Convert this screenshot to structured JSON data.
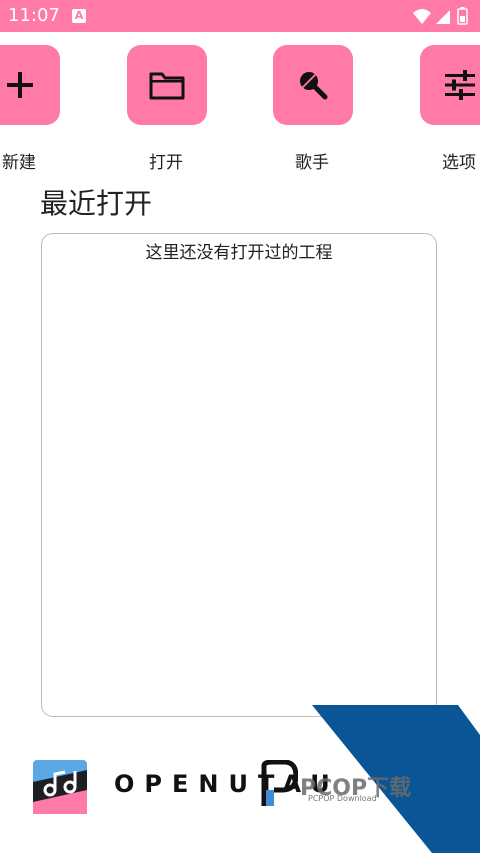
{
  "status_bar": {
    "time": "11:07",
    "app_badge": "A",
    "bg_color": "#ff7aa8"
  },
  "actions": [
    {
      "label": "新建",
      "icon": "plus-icon"
    },
    {
      "label": "打开",
      "icon": "folder-icon"
    },
    {
      "label": "歌手",
      "icon": "microphone-icon"
    },
    {
      "label": "选项",
      "icon": "sliders-icon"
    }
  ],
  "recent": {
    "title": "最近打开",
    "empty_text": "这里还没有打开过的工程"
  },
  "footer": {
    "brand": "OPENUTAU",
    "logo_icon": "openutau-logo-icon"
  },
  "watermark": {
    "text": "PCOP下载",
    "sub": "PCPOP Download",
    "color": "#0a5596"
  },
  "colors": {
    "accent": "#ff7aa8",
    "border": "#bdbdbd"
  }
}
